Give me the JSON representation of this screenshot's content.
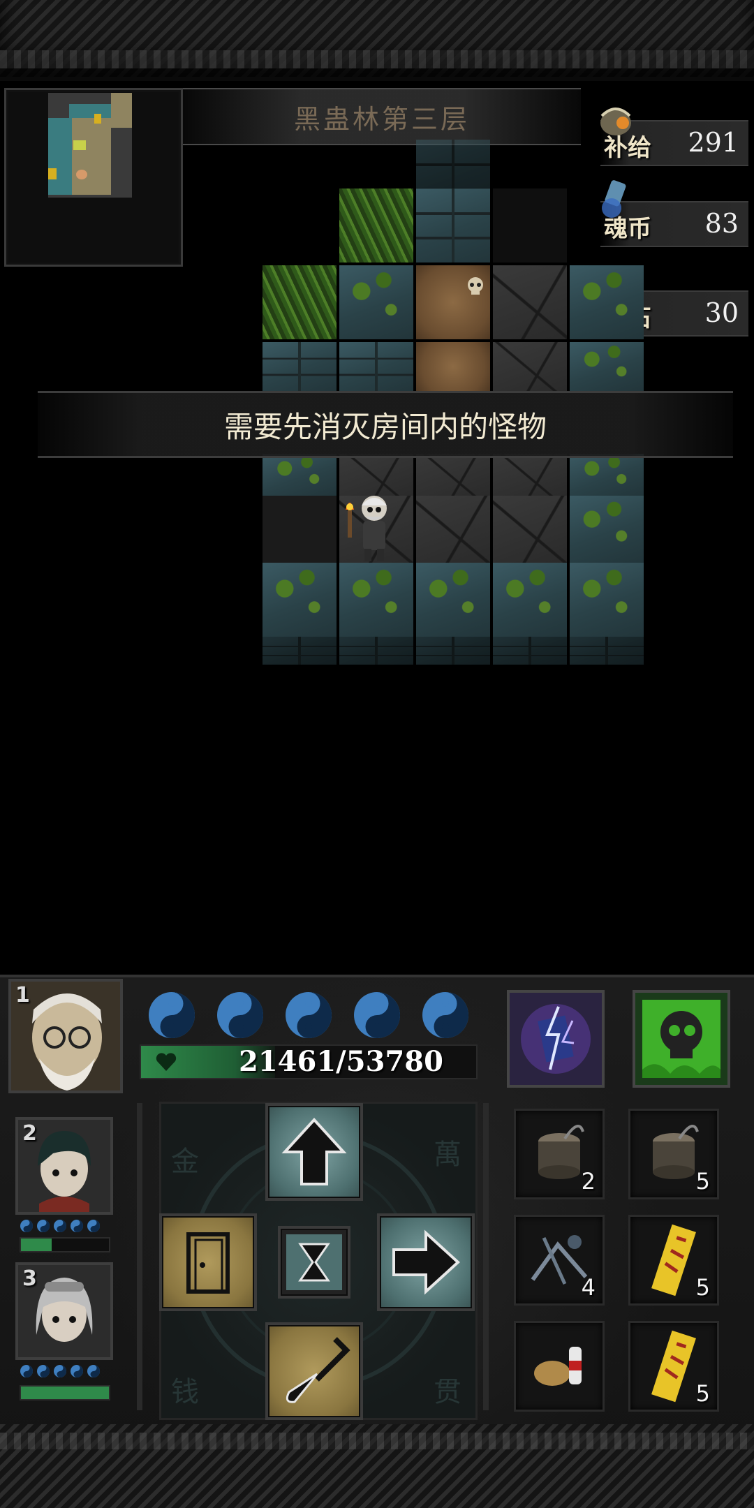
{
  "level": {
    "title": "黑蛊林第三层"
  },
  "resources": [
    {
      "label": "补给",
      "value": "291",
      "icon": "supply-pot-icon"
    },
    {
      "label": "魂币",
      "value": "83",
      "icon": "soul-coin-icon"
    },
    {
      "label": "钻石",
      "value": "30",
      "icon": "diamond-icon"
    }
  ],
  "message": "需要先消灭房间内的怪物",
  "party": {
    "leader": {
      "slot": "1",
      "hp": "21461/53780",
      "hp_fraction": 0.4,
      "orbs": 5
    },
    "members": [
      {
        "slot": "2",
        "orbs": 5,
        "hp_fraction": 0.35
      },
      {
        "slot": "3",
        "orbs": 5,
        "hp_fraction": 1.0
      }
    ]
  },
  "skills": [
    {
      "name": "lightning-skill-icon"
    },
    {
      "name": "poison-skull-skill-icon"
    }
  ],
  "dpad": {
    "background_glyphs": [
      "金",
      "萬",
      "钱",
      "贯"
    ]
  },
  "inventory": [
    {
      "icon": "stump-icon",
      "count": "2"
    },
    {
      "icon": "stump-icon",
      "count": "5"
    },
    {
      "icon": "bones-icon",
      "count": "4"
    },
    {
      "icon": "talisman-icon",
      "count": "5"
    },
    {
      "icon": "food-bottle-icon",
      "count": ""
    },
    {
      "icon": "talisman-icon",
      "count": "5"
    }
  ],
  "colors": {
    "accent_teal": "#4e7070",
    "accent_gold": "#8a7640",
    "hp_green": "#2f8a4a",
    "orb_blue": "#3f7fc0"
  }
}
